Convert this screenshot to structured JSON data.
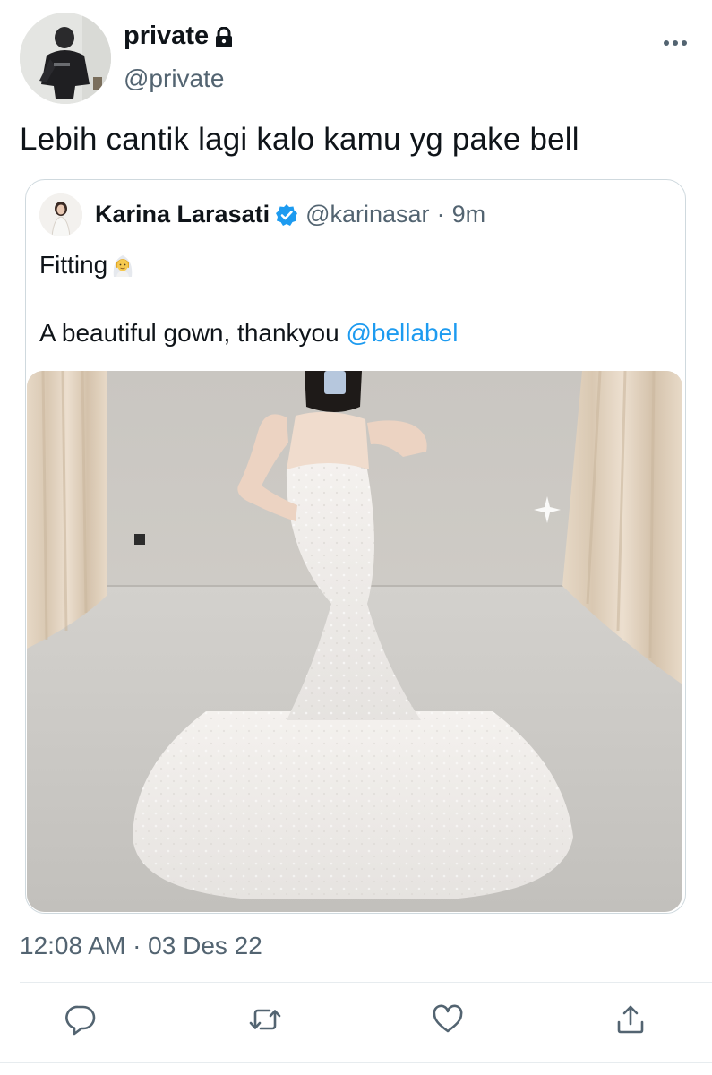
{
  "author": {
    "display_name": "private",
    "handle": "@private",
    "protected": true,
    "icons": {
      "lock": "lock-icon",
      "more": "more-horizontal-icon"
    }
  },
  "tweet": {
    "text": "Lebih cantik lagi kalo kamu yg pake bell",
    "timestamp": "12:08 AM · 03 Des 22"
  },
  "quoted_tweet": {
    "name": "Karina Larasati",
    "handle": "@karinasar",
    "separator": "·",
    "time_ago": "9m",
    "line1": "Fitting",
    "line1_emoji": "bride-with-veil-icon",
    "line2_prefix": "A beautiful gown, thankyou ",
    "mention": "@bellabel",
    "verified": true,
    "media": "photo-mirror-selfie-wedding-gown"
  },
  "actions": [
    {
      "name": "reply",
      "icon": "reply-icon"
    },
    {
      "name": "retweet",
      "icon": "retweet-icon"
    },
    {
      "name": "like",
      "icon": "heart-icon"
    },
    {
      "name": "share",
      "icon": "share-icon"
    }
  ],
  "colors": {
    "text_primary": "#0f1419",
    "text_secondary": "#536471",
    "link": "#1d9bf0",
    "border": "#cfd9de",
    "verified": "#1d9bf0"
  }
}
